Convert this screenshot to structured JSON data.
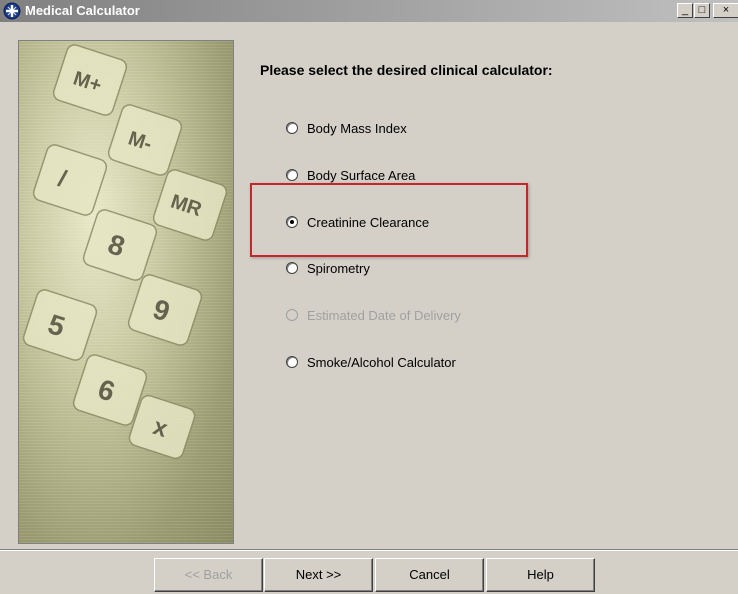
{
  "window": {
    "title": "Medical Calculator",
    "minimize_glyph": "_",
    "maximize_glyph": "□",
    "close_glyph": "×"
  },
  "prompt": "Please select the desired clinical calculator:",
  "options": [
    {
      "label": "Body Mass Index",
      "checked": false,
      "enabled": true
    },
    {
      "label": "Body Surface Area",
      "checked": false,
      "enabled": true
    },
    {
      "label": "Creatinine Clearance",
      "checked": true,
      "enabled": true
    },
    {
      "label": "Spirometry",
      "checked": false,
      "enabled": true
    },
    {
      "label": "Estimated Date of Delivery",
      "checked": false,
      "enabled": false
    },
    {
      "label": "Smoke/Alcohol Calculator",
      "checked": false,
      "enabled": true
    }
  ],
  "buttons": {
    "back": "<< Back",
    "next": "Next >>",
    "cancel": "Cancel",
    "help": "Help"
  },
  "image_keys": [
    "M+",
    "M-",
    "MR",
    "/",
    "8",
    "9",
    "5",
    "6",
    "x"
  ],
  "colors": {
    "highlight": "#c0282c",
    "title_bar_start": "#808080",
    "window_bg": "#d4d0c8"
  }
}
